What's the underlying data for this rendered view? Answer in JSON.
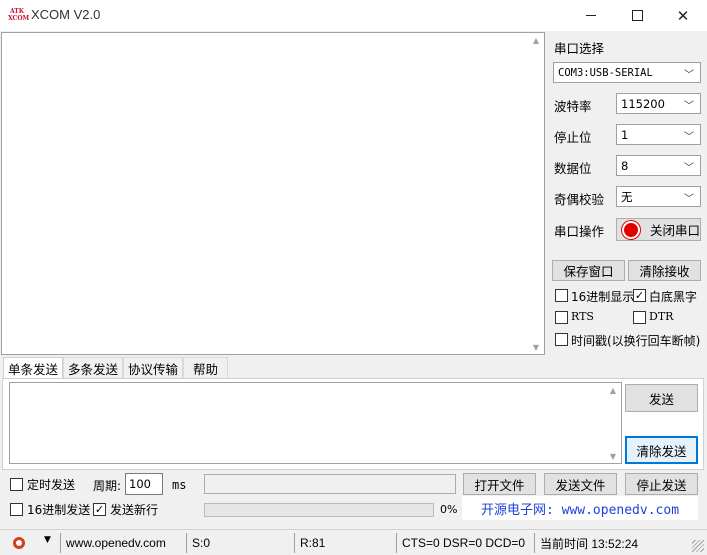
{
  "window": {
    "logo_top": "ATK",
    "logo_bottom": "XCOM",
    "title": "XCOM V2.0",
    "minimize_icon": "minimize-icon",
    "maximize_icon": "maximize-icon",
    "close_icon": "close-icon"
  },
  "serial": {
    "port_label": "串口选择",
    "port_value": "COM3:USB-SERIAL",
    "baud_label": "波特率",
    "baud_value": "115200",
    "stop_label": "停止位",
    "stop_value": "1",
    "data_label": "数据位",
    "data_value": "8",
    "parity_label": "奇偶校验",
    "parity_value": "无",
    "op_label": "串口操作",
    "close_port_label": "关闭串口",
    "port_indicator_color": "#e00000"
  },
  "receive": {
    "save_window_label": "保存窗口",
    "clear_receive_label": "清除接收",
    "hex_display_label": "16进制显示",
    "hex_display_checked": false,
    "white_black_label": "白底黑字",
    "white_black_checked": true,
    "rts_label": "RTS",
    "dtr_label": "DTR",
    "timestamp_label": "时间戳(以换行回车断帧)"
  },
  "tabs": [
    {
      "label": "单条发送",
      "active": true
    },
    {
      "label": "多条发送",
      "active": false
    },
    {
      "label": "协议传输",
      "active": false
    },
    {
      "label": "帮助",
      "active": false
    }
  ],
  "send": {
    "send_label": "发送",
    "clear_send_label": "清除发送",
    "timed_send_label": "定时发送",
    "period_label": "周期:",
    "period_value": "100",
    "period_unit": "ms",
    "open_file_label": "打开文件",
    "send_file_label": "发送文件",
    "stop_send_label": "停止发送",
    "hex_send_label": "16进制发送",
    "newline_label": "发送新行",
    "newline_checked": true,
    "progress_percent": 0,
    "progress_text": "0%",
    "website_banner": "开源电子网: www.openedv.com"
  },
  "statusbar": {
    "url": "www.openedv.com",
    "sent": "S:0",
    "received": "R:81",
    "signals": "CTS=0 DSR=0 DCD=0",
    "time": "当前时间 13:52:24"
  }
}
